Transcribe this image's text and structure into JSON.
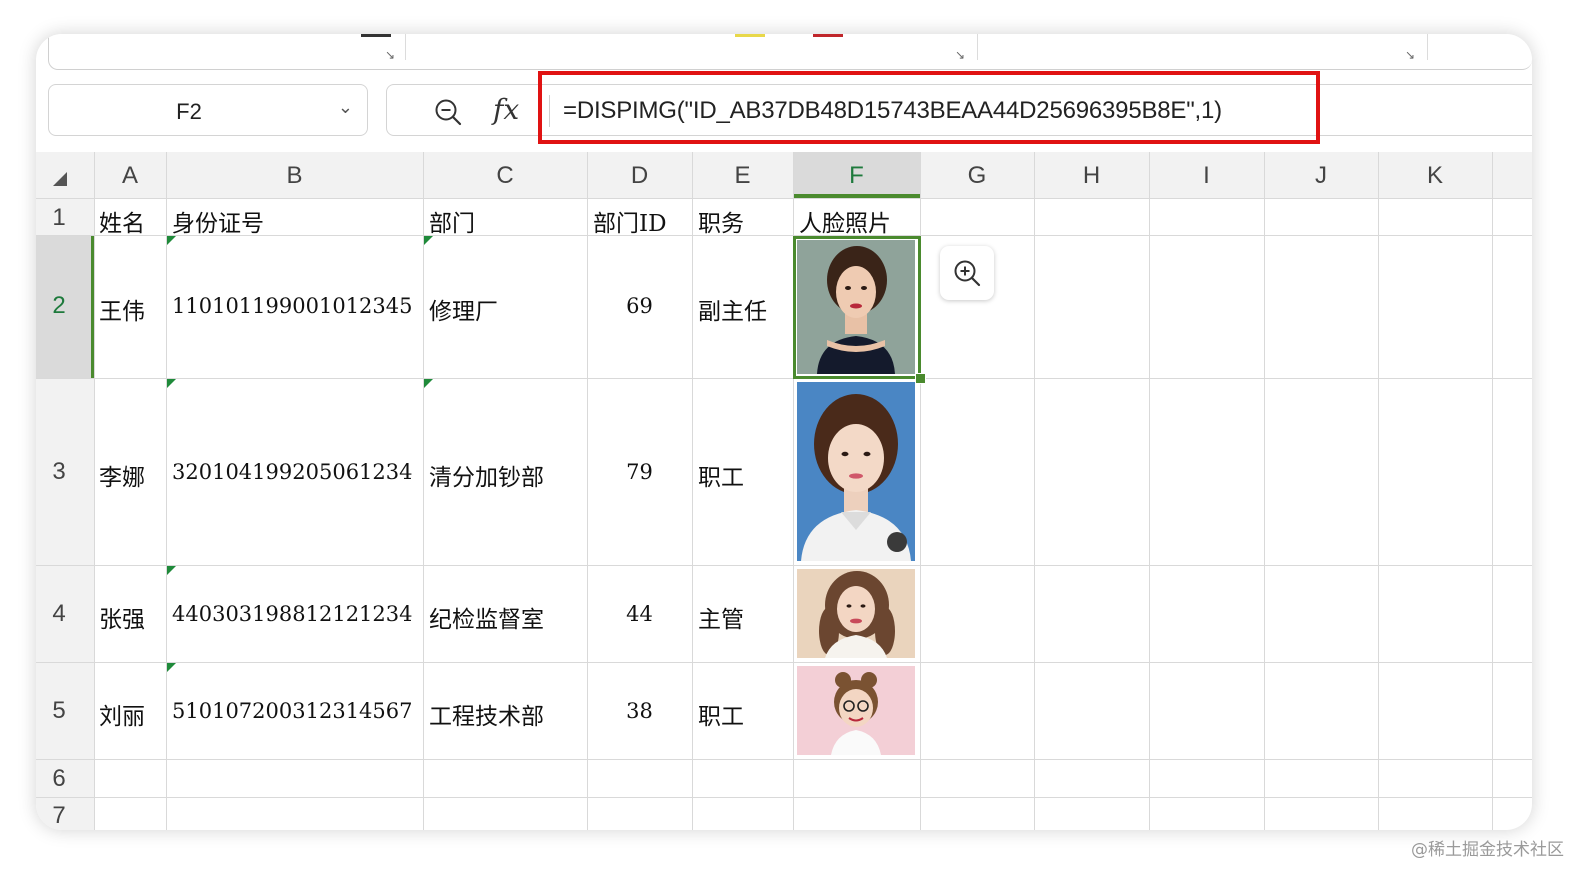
{
  "name_box": {
    "value": "F2"
  },
  "formula_bar": {
    "fx_label": "fx",
    "formula": "=DISPIMG(\"ID_AB37DB48D15743BEAA44D25696395B8E\",1)"
  },
  "columns": [
    "A",
    "B",
    "C",
    "D",
    "E",
    "F",
    "G",
    "H",
    "I",
    "J",
    "K"
  ],
  "rows": [
    "1",
    "2",
    "3",
    "4",
    "5",
    "6",
    "7"
  ],
  "selected_cell": {
    "column": "F",
    "row": "2"
  },
  "table": {
    "headers": [
      "姓名",
      "身份证号",
      "部门",
      "部门ID",
      "职务",
      "人脸照片"
    ],
    "records": [
      {
        "name": "王伟",
        "id_number": "110101199001012345",
        "department": "修理厂",
        "dept_id": "69",
        "title": "副主任",
        "photo": "face-photo-1"
      },
      {
        "name": "李娜",
        "id_number": "320104199205061234",
        "department": "清分加钞部",
        "dept_id": "79",
        "title": "职工",
        "photo": "face-photo-2"
      },
      {
        "name": "张强",
        "id_number": "440303198812121234",
        "department": "纪检监督室",
        "dept_id": "44",
        "title": "主管",
        "photo": "face-photo-3"
      },
      {
        "name": "刘丽",
        "id_number": "510107200312314567",
        "department": "工程技术部",
        "dept_id": "38",
        "title": "职工",
        "photo": "face-photo-4"
      }
    ]
  },
  "icons": {
    "zoom_out": "zoom-out-icon",
    "zoom_in": "zoom-in-icon",
    "dropdown": "chevron-down-icon",
    "corner": "select-all-corner-icon"
  },
  "colors": {
    "highlight": "#e01212",
    "selection": "#4a8a2e",
    "comment_marker": "#1f8a3a"
  },
  "watermark": "@稀土掘金技术社区"
}
